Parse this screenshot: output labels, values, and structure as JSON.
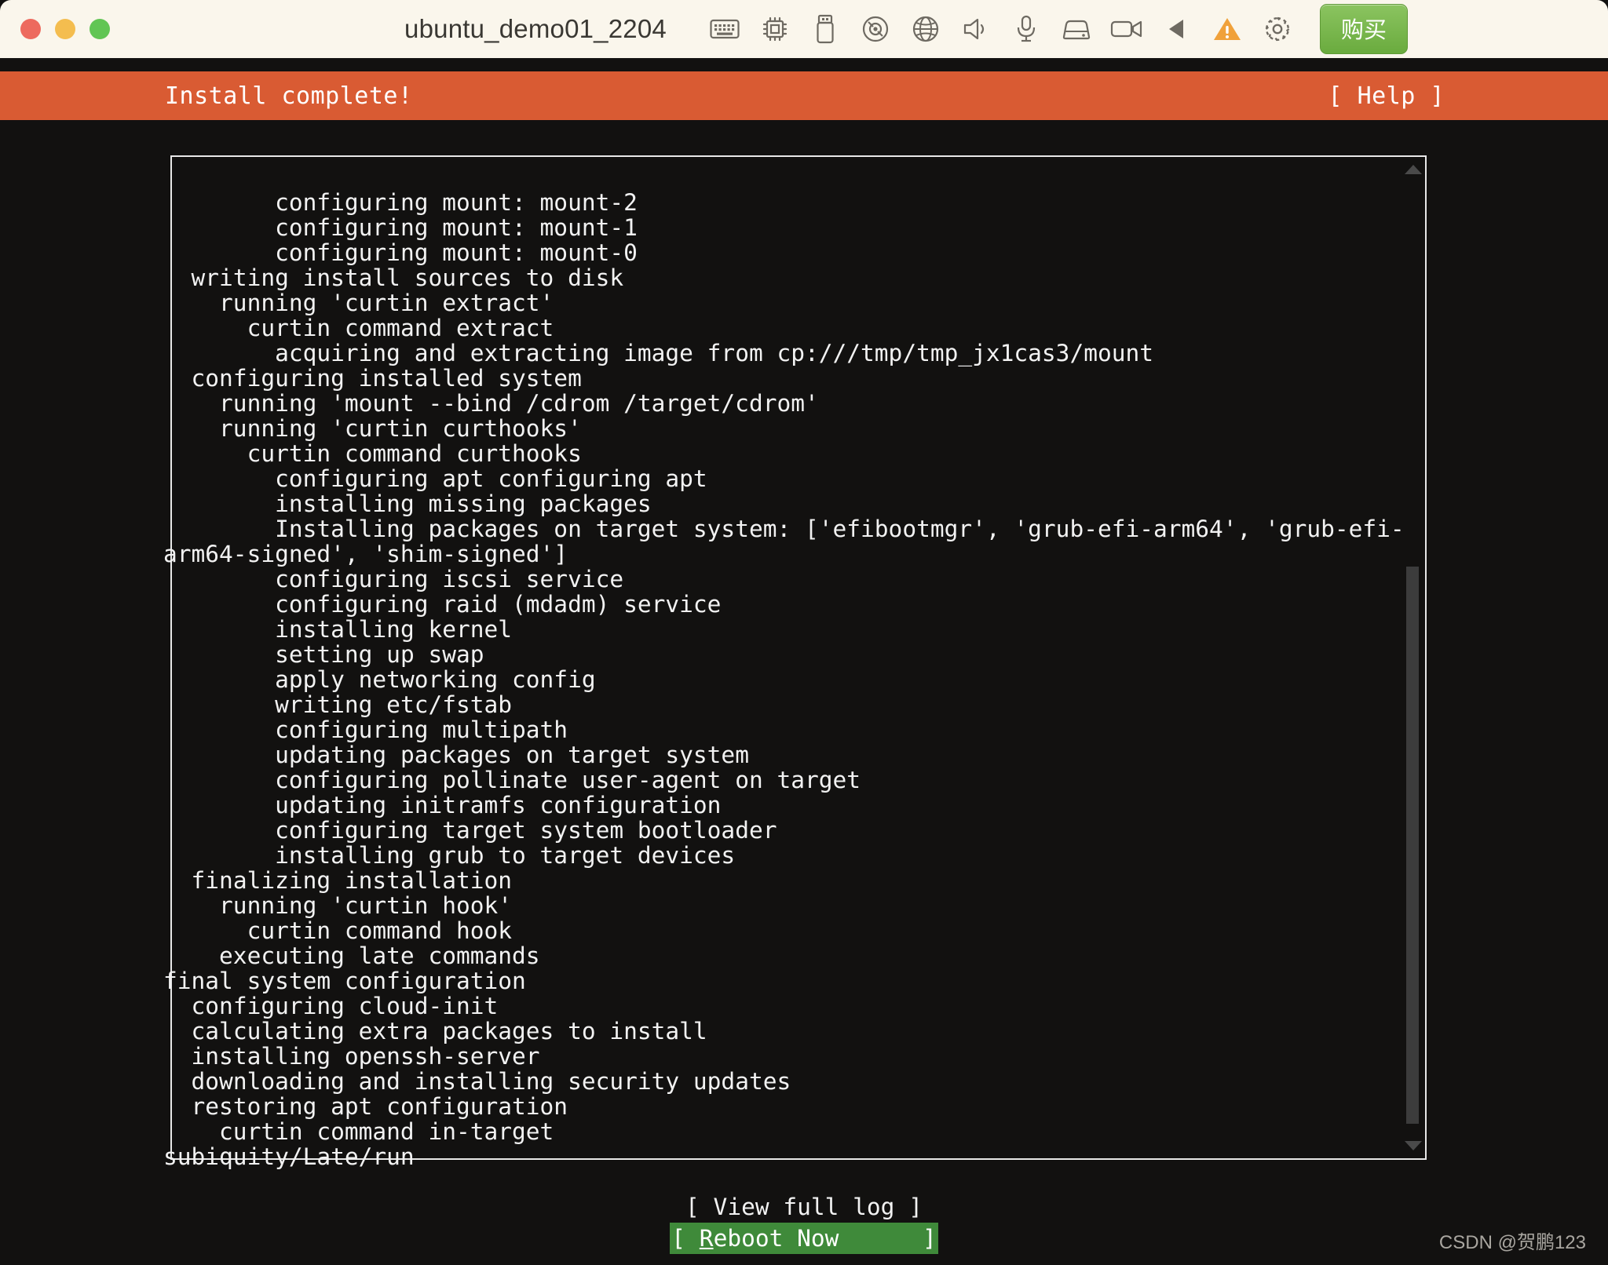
{
  "window": {
    "title": "ubuntu_demo01_2204",
    "traffic_lights": [
      {
        "name": "close",
        "color": "#ed6a5e"
      },
      {
        "name": "minimize",
        "color": "#f4bd4f"
      },
      {
        "name": "maximize",
        "color": "#61c554"
      }
    ],
    "toolbar_icons": [
      {
        "name": "keyboard-icon",
        "label": "keyboard"
      },
      {
        "name": "cpu-icon",
        "label": "cpu"
      },
      {
        "name": "usb-drive-icon",
        "label": "usb"
      },
      {
        "name": "optical-disc-icon",
        "label": "cd-dvd"
      },
      {
        "name": "network-globe-icon",
        "label": "network"
      },
      {
        "name": "speaker-icon",
        "label": "sound"
      },
      {
        "name": "microphone-icon",
        "label": "microphone"
      },
      {
        "name": "hard-disk-icon",
        "label": "disk"
      },
      {
        "name": "camera-icon",
        "label": "camera"
      },
      {
        "name": "back-triangle-icon",
        "label": "back"
      },
      {
        "name": "warning-icon",
        "label": "warning"
      },
      {
        "name": "gear-icon",
        "label": "settings"
      }
    ],
    "buy_button_label": "购买",
    "buy_button_color": "#6aab3e"
  },
  "installer": {
    "header_title": "Install complete!",
    "header_help": "[ Help ]",
    "header_color": "#d95b33",
    "log": "        configuring mount: mount-2\n        configuring mount: mount-1\n        configuring mount: mount-0\n  writing install sources to disk\n    running 'curtin extract'\n      curtin command extract\n        acquiring and extracting image from cp:///tmp/tmp_jx1cas3/mount\n  configuring installed system\n    running 'mount --bind /cdrom /target/cdrom'\n    running 'curtin curthooks'\n      curtin command curthooks\n        configuring apt configuring apt\n        installing missing packages\n        Installing packages on target system: ['efibootmgr', 'grub-efi-arm64', 'grub-efi-arm64-signed', 'shim-signed']\n        configuring iscsi service\n        configuring raid (mdadm) service\n        installing kernel\n        setting up swap\n        apply networking config\n        writing etc/fstab\n        configuring multipath\n        updating packages on target system\n        configuring pollinate user-agent on target\n        updating initramfs configuration\n        configuring target system bootloader\n        installing grub to target devices\n  finalizing installation\n    running 'curtin hook'\n      curtin command hook\n    executing late commands\nfinal system configuration\n  configuring cloud-init\n  calculating extra packages to install\n  installing openssh-server\n  downloading and installing security updates\n  restoring apt configuration\n    curtin command in-target\nsubiquity/Late/run",
    "buttons": {
      "view_full_log": "[ View full log ]",
      "reboot_open": "[ ",
      "reboot_mnemonic": "R",
      "reboot_rest": "eboot Now      ]",
      "reboot_full": "[ Reboot Now      ]",
      "reboot_highlight_color": "#3f8a3a"
    }
  },
  "watermark": "CSDN @贺鹏123"
}
